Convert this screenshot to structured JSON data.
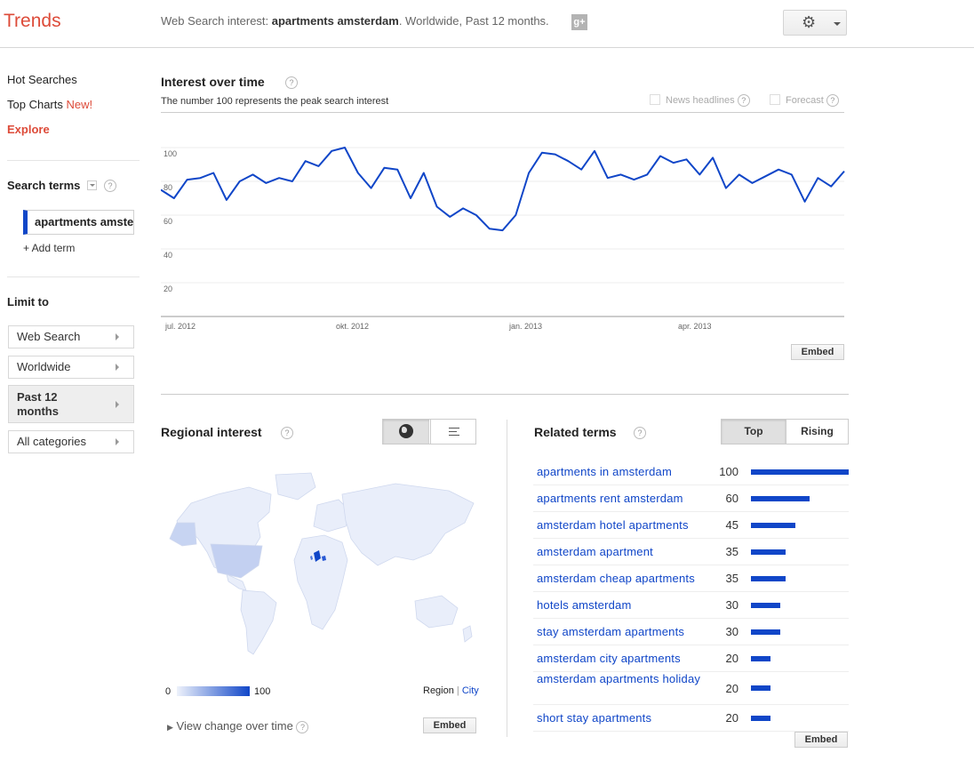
{
  "header": {
    "logo": "Trends",
    "query_prefix": "Web Search interest: ",
    "query_term": "apartments amsterdam",
    "query_suffix": ". Worldwide, Past 12 months.",
    "gplus_icon": "google-plus-icon",
    "settings_icon": "gear-icon"
  },
  "sidebar": {
    "nav": [
      {
        "label": "Hot Searches"
      },
      {
        "label": "Top Charts",
        "badge": "New!"
      },
      {
        "label": "Explore"
      }
    ],
    "search_terms_heading": "Search terms",
    "term": "apartments amsterdam",
    "add_term": "+ Add term",
    "limit_heading": "Limit to",
    "limits": [
      {
        "label": "Web Search"
      },
      {
        "label": "Worldwide"
      },
      {
        "label": "Past 12 months"
      },
      {
        "label": "All categories"
      }
    ]
  },
  "interest": {
    "title": "Interest over time",
    "subtitle": "The number 100 represents the peak search interest",
    "news_headlines": "News headlines",
    "forecast": "Forecast",
    "embed": "Embed"
  },
  "chart_data": {
    "type": "line",
    "title": "",
    "xlabel": "",
    "ylabel": "",
    "ylim": [
      0,
      100
    ],
    "y_ticks": [
      100,
      80,
      60,
      40,
      20
    ],
    "x_tick_labels": [
      "jul. 2012",
      "okt. 2012",
      "jan. 2013",
      "apr. 2013"
    ],
    "grid": true,
    "values": [
      75,
      70,
      81,
      82,
      85,
      69,
      80,
      84,
      79,
      82,
      80,
      92,
      89,
      98,
      100,
      85,
      76,
      88,
      87,
      70,
      85,
      65,
      59,
      64,
      60,
      52,
      51,
      60,
      85,
      97,
      96,
      92,
      87,
      98,
      82,
      84,
      81,
      84,
      95,
      91,
      93,
      84,
      94,
      76,
      84,
      79,
      83,
      87,
      84,
      68,
      82,
      77,
      86
    ]
  },
  "regional": {
    "title": "Regional interest",
    "globe_icon": "globe-icon",
    "list_icon": "list-icon",
    "legend_min": "0",
    "legend_max": "100",
    "region": "Region",
    "city": "City",
    "view_change": "View change over time",
    "embed": "Embed"
  },
  "related": {
    "title": "Related terms",
    "tab_top": "Top",
    "tab_rising": "Rising",
    "embed": "Embed",
    "items": [
      {
        "term": "apartments in amsterdam",
        "value": 100
      },
      {
        "term": "apartments rent amsterdam",
        "value": 60
      },
      {
        "term": "amsterdam hotel apartments",
        "value": 45
      },
      {
        "term": "amsterdam apartment",
        "value": 35
      },
      {
        "term": "amsterdam cheap apartments",
        "value": 35
      },
      {
        "term": "hotels amsterdam",
        "value": 30
      },
      {
        "term": "stay amsterdam apartments",
        "value": 30
      },
      {
        "term": "amsterdam city apartments",
        "value": 20
      },
      {
        "term": "amsterdam apartments holiday",
        "value": 20
      },
      {
        "term": "short stay apartments",
        "value": 20
      }
    ]
  },
  "colors": {
    "brand": "#dd4b39",
    "accent": "#1046c8"
  }
}
